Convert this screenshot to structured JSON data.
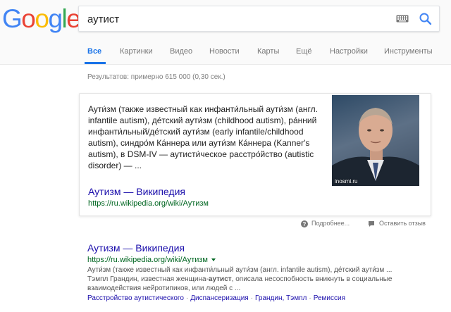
{
  "logo": {
    "letters": [
      "G",
      "o",
      "o",
      "g",
      "l",
      "e"
    ]
  },
  "search": {
    "query": "аутист"
  },
  "tabs": [
    {
      "label": "Все",
      "active": true
    },
    {
      "label": "Картинки",
      "active": false
    },
    {
      "label": "Видео",
      "active": false
    },
    {
      "label": "Новости",
      "active": false
    },
    {
      "label": "Карты",
      "active": false
    },
    {
      "label": "Ещё",
      "active": false
    },
    {
      "label": "Настройки",
      "active": false
    },
    {
      "label": "Инструменты",
      "active": false
    }
  ],
  "results_stats": "Результатов: примерно 615 000 (0,30 сек.)",
  "featured": {
    "snippet": "Аути́зм (также известный как инфанти́льный аути́зм (англ. infantile autism), де́тский аути́зм (childhood autism), ра́нний инфанти́льный/де́тский аути́зм (early infantile/childhood autism), синдро́м Ка́ннера или аути́зм Ка́ннера (Kanner's autism), в DSM-IV — аутисти́ческое расстро́йство (autistic disorder) — ...",
    "image_caption": "inosmi.ru",
    "link_title": "Аутизм — Википедия",
    "link_url": "https://ru.wikipedia.org/wiki/Аутизм"
  },
  "feedback": {
    "more": "Подробнее...",
    "report": "Оставить отзыв"
  },
  "result": {
    "title": "Аутизм — Википедия",
    "url": "https://ru.wikipedia.org/wiki/Аутизм",
    "snippet_line1": "Аути́зм (также известный как инфанти́льный аути́зм (англ. infantile autism), де́тский аути́зм ...",
    "snippet_line2_pre": "Тэмпл Грандин, известная женщина-",
    "snippet_line2_bold": "аутист",
    "snippet_line2_post": ", описала несоспобность вникнуть в социальные",
    "snippet_line3": "взаимодействия нейротипиков, или людей с ...",
    "sitelinks": [
      "Расстройство аутистического",
      "Диспансеризация",
      "Грандин, Тэмпл",
      "Ремиссия"
    ]
  },
  "colors": {
    "link": "#1a0dab",
    "url": "#006621",
    "accent": "#1a73e8"
  }
}
